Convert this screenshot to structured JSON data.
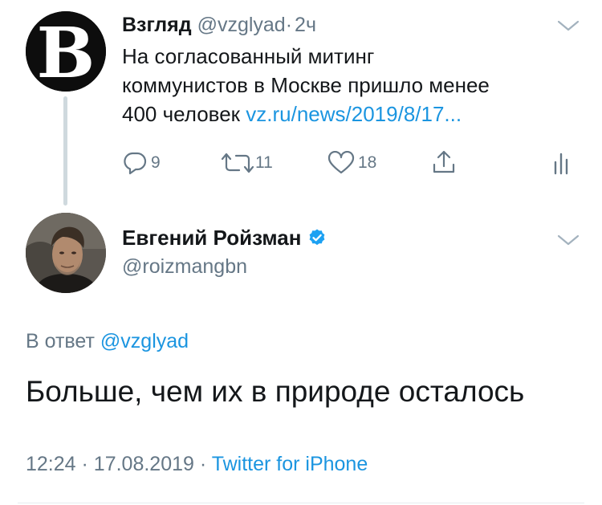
{
  "parent_tweet": {
    "avatar_letter": "B",
    "display_name": "Взгляд",
    "handle": "@vzglyad",
    "separator": "·",
    "time_ago": "2ч",
    "text_lines": [
      "На согласованный митинг",
      "коммунистов в Москве пришло менее",
      "400 человек"
    ],
    "link_text": "vz.ru/news/2019/8/17...",
    "actions": {
      "reply_count": "9",
      "retweet_count": "11",
      "like_count": "18"
    },
    "icons": [
      "reply-icon",
      "retweet-icon",
      "like-icon",
      "share-icon",
      "analytics-icon",
      "chevron-down-icon"
    ]
  },
  "reply_tweet": {
    "display_name": "Евгений Ройзман",
    "verified": true,
    "handle": "@roizmangbn",
    "reply_to_prefix": "В ответ",
    "reply_to_handle": "@vzglyad",
    "text": "Больше, чем их в природе осталось",
    "time": "12:24",
    "date": "17.08.2019",
    "meta_separator": "·",
    "source": "Twitter for iPhone"
  },
  "colors": {
    "link": "#1b95e0",
    "muted": "#657786",
    "verified": "#1da1f2",
    "thread_line": "#cfd9de"
  }
}
